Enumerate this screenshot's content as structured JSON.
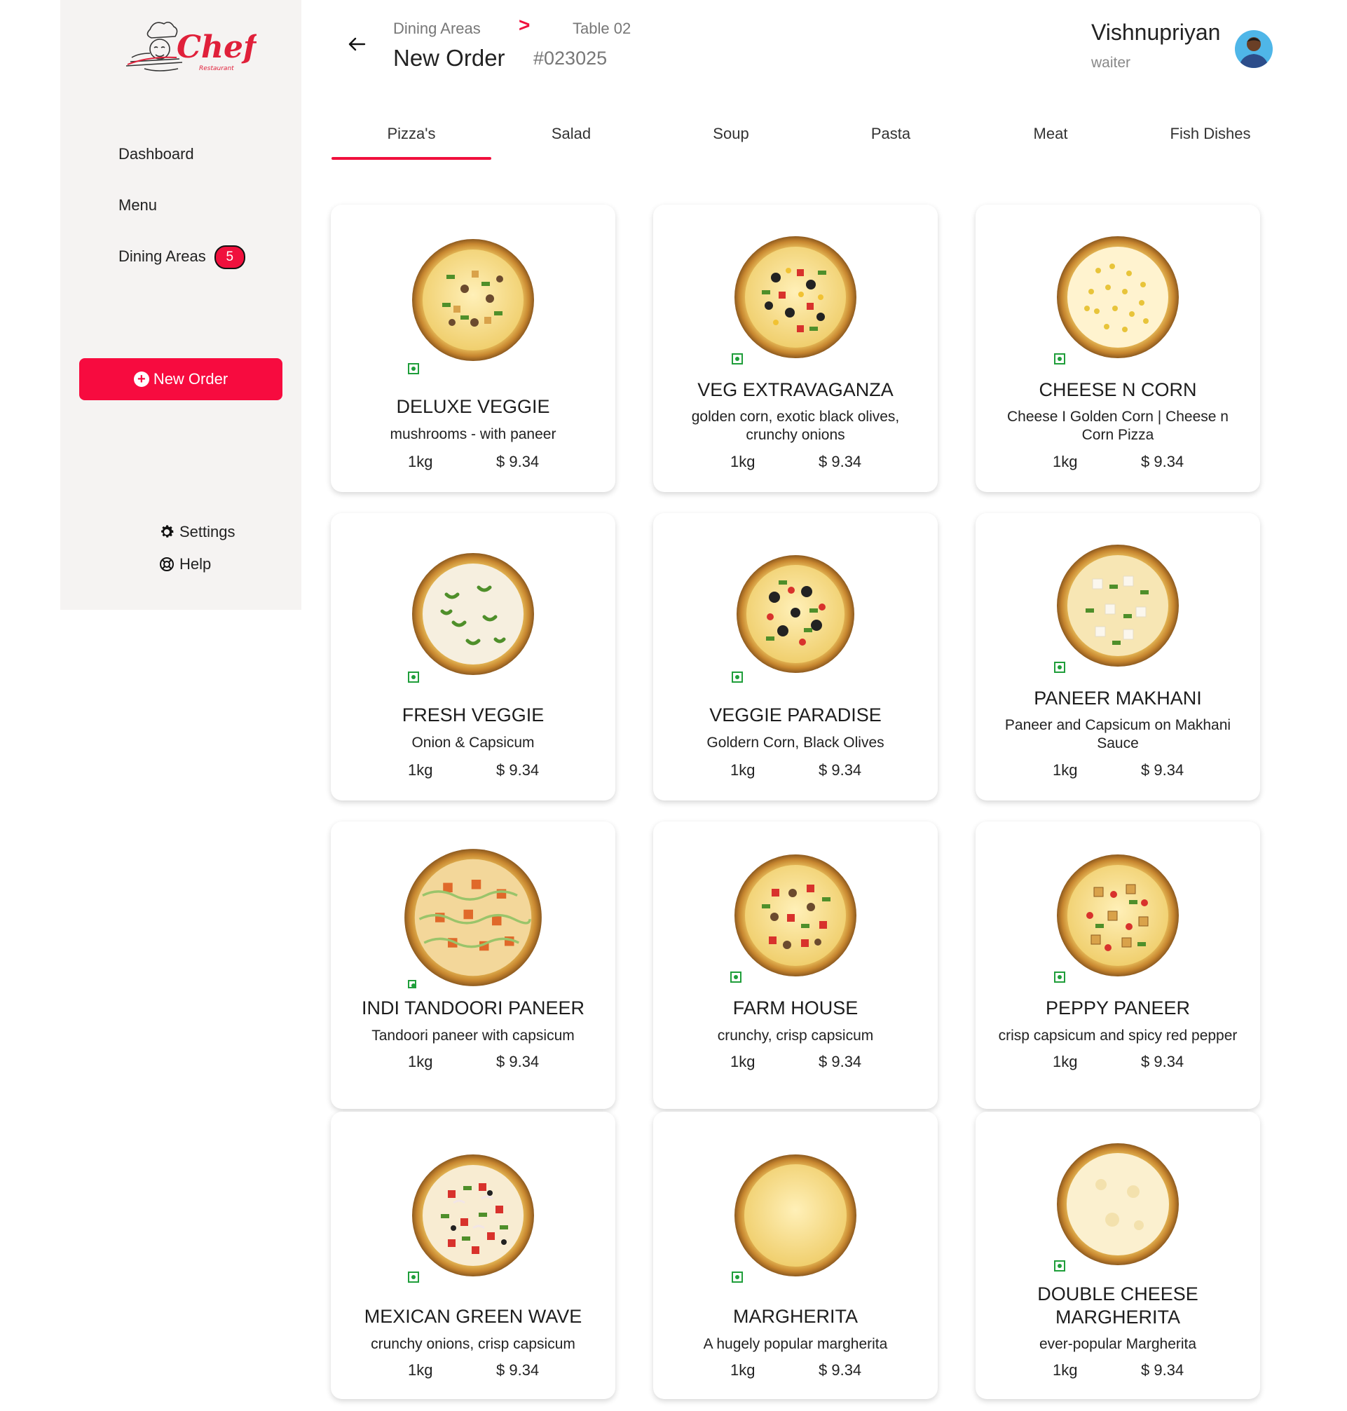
{
  "brand": {
    "name": "Chefs",
    "sub": "Restaurant",
    "accent": "#f70b3f"
  },
  "sidebar": {
    "items": [
      {
        "label": "Dashboard"
      },
      {
        "label": "Menu"
      },
      {
        "label": "Dining Areas",
        "badge": "5"
      }
    ],
    "new_order_label": "New Order",
    "settings_label": "Settings",
    "help_label": "Help"
  },
  "header": {
    "breadcrumb": [
      "Dining Areas",
      ">",
      "Table 02"
    ],
    "title": "New Order",
    "order_id": "#023025"
  },
  "user": {
    "name": "Vishnupriyan",
    "role": "waiter"
  },
  "tabs": [
    {
      "label": "Pizza's",
      "active": true
    },
    {
      "label": "Salad"
    },
    {
      "label": "Soup"
    },
    {
      "label": "Pasta"
    },
    {
      "label": "Meat"
    },
    {
      "label": "Fish Dishes"
    }
  ],
  "items": [
    {
      "name": "DELUXE VEGGIE",
      "desc": "mushrooms - with paneer",
      "weight": "1kg",
      "price": "$ 9.34"
    },
    {
      "name": "VEG EXTRAVAGANZA",
      "desc": "golden corn, exotic black olives, crunchy onions",
      "weight": "1kg",
      "price": "$ 9.34"
    },
    {
      "name": "CHEESE N CORN",
      "desc": "Cheese I Golden Corn | Cheese n Corn Pizza",
      "weight": "1kg",
      "price": "$ 9.34"
    },
    {
      "name": "FRESH VEGGIE",
      "desc": "Onion & Capsicum",
      "weight": "1kg",
      "price": "$ 9.34"
    },
    {
      "name": "VEGGIE PARADISE",
      "desc": "Goldern Corn, Black Olives",
      "weight": "1kg",
      "price": "$ 9.34"
    },
    {
      "name": "PANEER MAKHANI",
      "desc": "Paneer and Capsicum on Makhani Sauce",
      "weight": "1kg",
      "price": "$ 9.34"
    },
    {
      "name": "INDI TANDOORI PANEER",
      "desc": "Tandoori paneer with capsicum",
      "weight": "1kg",
      "price": "$ 9.34"
    },
    {
      "name": "FARM HOUSE",
      "desc": "crunchy, crisp capsicum",
      "weight": "1kg",
      "price": "$ 9.34"
    },
    {
      "name": "PEPPY PANEER",
      "desc": "crisp capsicum and spicy red pepper",
      "weight": "1kg",
      "price": "$ 9.34"
    },
    {
      "name": "MEXICAN GREEN WAVE",
      "desc": "crunchy onions, crisp capsicum",
      "weight": "1kg",
      "price": "$ 9.34"
    },
    {
      "name": "MARGHERITA",
      "desc": "A hugely popular margherita",
      "weight": "1kg",
      "price": "$ 9.34"
    },
    {
      "name": "DOUBLE CHEESE MARGHERITA",
      "desc": "ever-popular Margherita",
      "weight": "1kg",
      "price": "$ 9.34"
    }
  ]
}
